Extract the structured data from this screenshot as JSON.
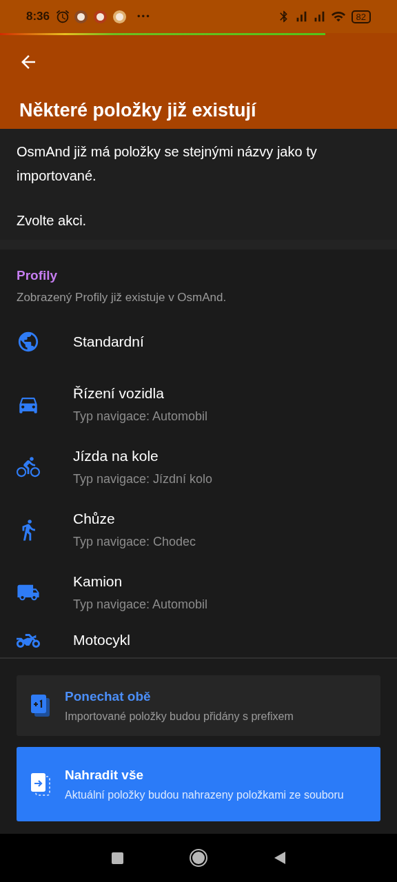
{
  "status_bar": {
    "time": "8:36",
    "more": "•••",
    "battery": "82"
  },
  "battery_bar": {
    "level": 0.82
  },
  "header": {
    "title": "Některé položky již existují"
  },
  "intro": {
    "message": "OsmAnd již má položky se stejnými názvy jako ty importované.",
    "prompt": "Zvolte akci."
  },
  "section": {
    "title": "Profily",
    "description": "Zobrazený Profily již existuje v OsmAnd."
  },
  "profiles": [
    {
      "kind": "globe",
      "name": "Standardní"
    },
    {
      "kind": "car",
      "name": "Řízení vozidla",
      "subtitle": "Typ navigace: Automobil"
    },
    {
      "kind": "bike",
      "name": "Jízda na kole",
      "subtitle": "Typ navigace: Jízdní kolo"
    },
    {
      "kind": "walk",
      "name": "Chůze",
      "subtitle": "Typ navigace: Chodec"
    },
    {
      "kind": "truck",
      "name": "Kamion",
      "subtitle": "Typ navigace: Automobil"
    },
    {
      "kind": "moto",
      "name": "Motocykl"
    }
  ],
  "actions": [
    {
      "kind": "keep",
      "primary": false,
      "title": "Ponechat obě",
      "description": "Importované položky budou přidány s prefixem"
    },
    {
      "kind": "replace",
      "primary": true,
      "title": "Nahradit vše",
      "description": "Aktuální položky budou nahrazeny položkami ze souboru"
    }
  ]
}
